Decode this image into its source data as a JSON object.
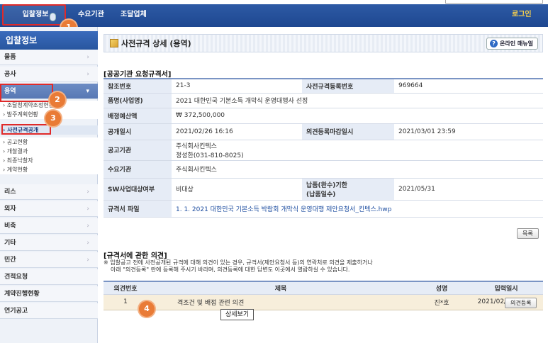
{
  "nav": {
    "bid": "입찰정보",
    "demand": "수요기관",
    "supplier": "조달업체",
    "login": "로그인"
  },
  "badges": [
    "1",
    "2",
    "3",
    "4"
  ],
  "sidebar": {
    "title": "입찰정보",
    "top_items": [
      "물품",
      "공사"
    ],
    "active": "용역",
    "sub_items": [
      "조달청계약조정현황",
      "발주계획현황",
      "사전규격공개",
      "공고현황",
      "개찰결과",
      "최종낙찰자",
      "계약현황"
    ],
    "bottom_items": [
      "리스",
      "외자",
      "비축",
      "기타",
      "민간",
      "견적요청",
      "계약진행현황",
      "연기공고"
    ]
  },
  "title_bar": {
    "title": "사전규격 상세 (용역)",
    "manual": "온라인 매뉴얼",
    "help_glyph": "?"
  },
  "spec": {
    "heading": "[공공기관 요청규격서]",
    "ref_no_label": "참조번호",
    "ref_no": "21-3",
    "spec_no_label": "사전규격등록번호",
    "spec_no": "969664",
    "name_label": "품명(사업명)",
    "name": "2021 대한민국 기본소득 개막식 운영대행사 선정",
    "budget_label": "배정예산액",
    "budget": "₩ 372,500,000",
    "open_date_label": "공개일시",
    "open_date": "2021/02/26 16:16",
    "deadline_label": "의견등록마감일시",
    "deadline": "2021/03/01 23:59",
    "agency_label": "공고기관",
    "agency": "주식회사킨텍스",
    "agency_contact": "정성한(031-810-8025)",
    "demand_label": "수요기관",
    "demand": "주식회사킨텍스",
    "sw_label": "SW사업대상여부",
    "sw": "비대상",
    "delivery_label": "납품(완수)기한",
    "delivery_label2": "(납품일수)",
    "delivery": "2021/05/31",
    "file_label": "규격서 파일",
    "file": "1. 1. 2021 대한민국 기본소득 박람회 개막식 운영대행 제안요청서_킨텍스.hwp"
  },
  "list_button": "목록",
  "comments": {
    "heading": "[규격서에 관한 의견]",
    "notice1": "※ 입찰공고 전에 사전공개된 규격에 대해 의견이 있는 경우, 규격서(제안요청서 등)의 연락처로 의견을 제출하거나",
    "notice2": "아래 \"의견등록\" 란에 등록해 주시기 바라며, 의견등록에 대한 답변도 이곳에서 열람하실 수 있습니다.",
    "columns": [
      "의견번호",
      "제목",
      "성명",
      "입력일시"
    ],
    "rows": [
      {
        "no": "1",
        "title": "격조건 및 배점 관련 의견",
        "name": "진*호",
        "date": "2021/02/26 18:42"
      }
    ],
    "tooltip": "상세보기",
    "register_button": "의견등록"
  }
}
